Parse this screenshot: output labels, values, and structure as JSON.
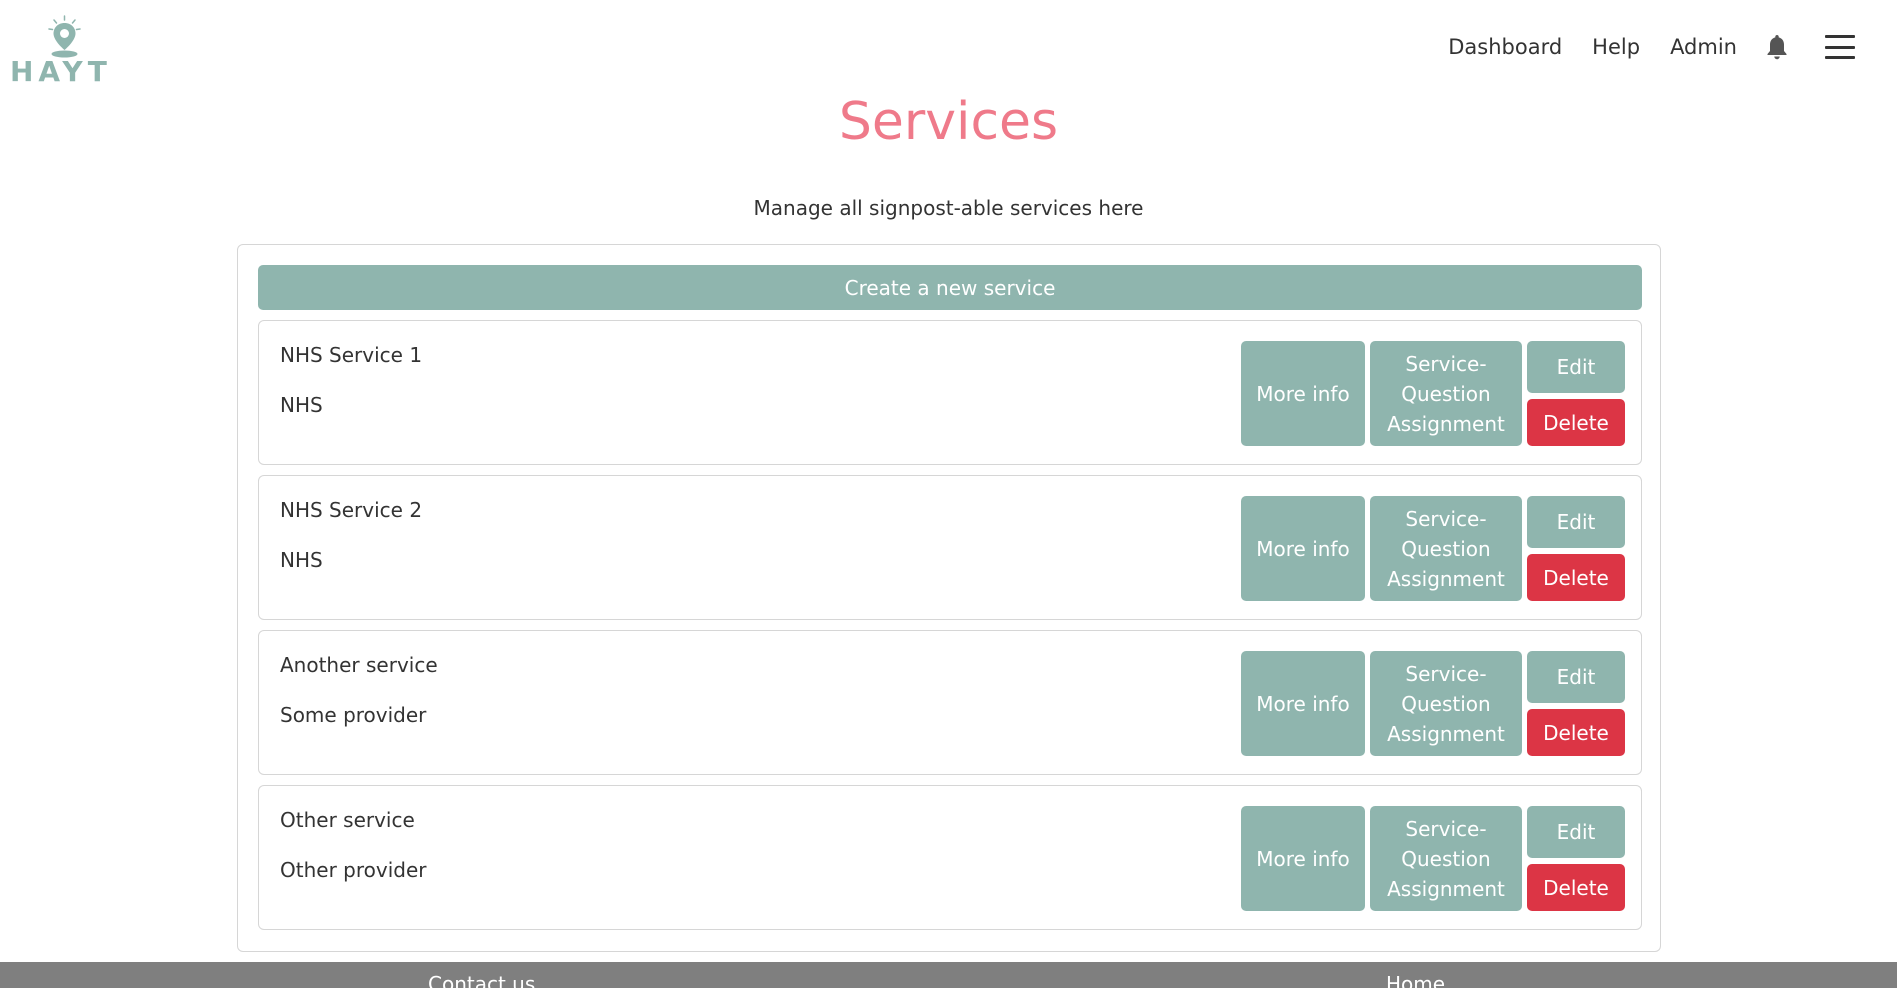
{
  "brand": {
    "logo_text": "HAYT",
    "accent_color": "#8fb5ae"
  },
  "nav": {
    "links": [
      "Dashboard",
      "Help",
      "Admin"
    ],
    "bell_icon": "bell-icon",
    "menu_icon": "hamburger-menu-icon"
  },
  "page": {
    "title": "Services",
    "subtitle": "Manage all signpost-able services here",
    "title_color": "#ef7a8a"
  },
  "create_button": "Create a new service",
  "buttons": {
    "more_info": "More info",
    "assignment": "Service-Question Assignment",
    "edit": "Edit",
    "delete": "Delete",
    "delete_color": "#dc3545"
  },
  "services": [
    {
      "name": "NHS Service 1",
      "provider": "NHS"
    },
    {
      "name": "NHS Service 2",
      "provider": "NHS"
    },
    {
      "name": "Another service",
      "provider": "Some provider"
    },
    {
      "name": "Other service",
      "provider": "Other provider"
    }
  ],
  "footer": {
    "contact": "Contact us",
    "home": "Home"
  }
}
